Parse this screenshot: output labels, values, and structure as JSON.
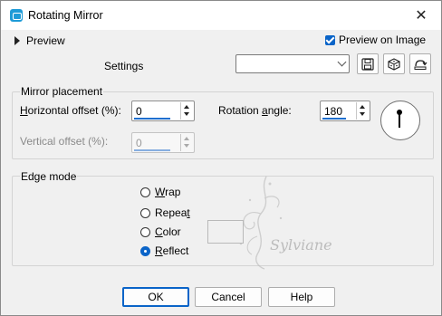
{
  "window": {
    "title": "Rotating Mirror",
    "close_glyph": "✕"
  },
  "header": {
    "preview_label": "Preview",
    "preview_on_image_label": "Preview on Image",
    "preview_on_image_checked": true,
    "settings_label": "Settings",
    "settings_value": ""
  },
  "toolbar": {
    "icons": [
      "save-icon",
      "randomize-icon",
      "reset-icon"
    ]
  },
  "mirror_placement": {
    "title": "Mirror placement",
    "horizontal_offset": {
      "label_first": "H",
      "label_rest": "orizontal offset (%):",
      "value": "0"
    },
    "vertical_offset": {
      "label": "Vertical offset (%):",
      "value": "0",
      "enabled": false
    },
    "rotation_angle": {
      "label_pre": "Rotation ",
      "label_ul": "a",
      "label_post": "ngle:",
      "value": "180"
    }
  },
  "edge_mode": {
    "title": "Edge mode",
    "options": [
      {
        "ul": "W",
        "rest": "rap",
        "selected": false
      },
      {
        "pre": "Repea",
        "ul": "t",
        "selected": false
      },
      {
        "ul": "C",
        "rest": "olor",
        "selected": false
      },
      {
        "ul": "R",
        "rest": "eflect",
        "selected": true
      }
    ]
  },
  "watermark": {
    "text": "Sylviane"
  },
  "buttons": {
    "ok": "OK",
    "cancel": "Cancel",
    "help": "Help"
  },
  "colors": {
    "accent": "#0a64c8",
    "app_icon": "#1e9bd7"
  }
}
